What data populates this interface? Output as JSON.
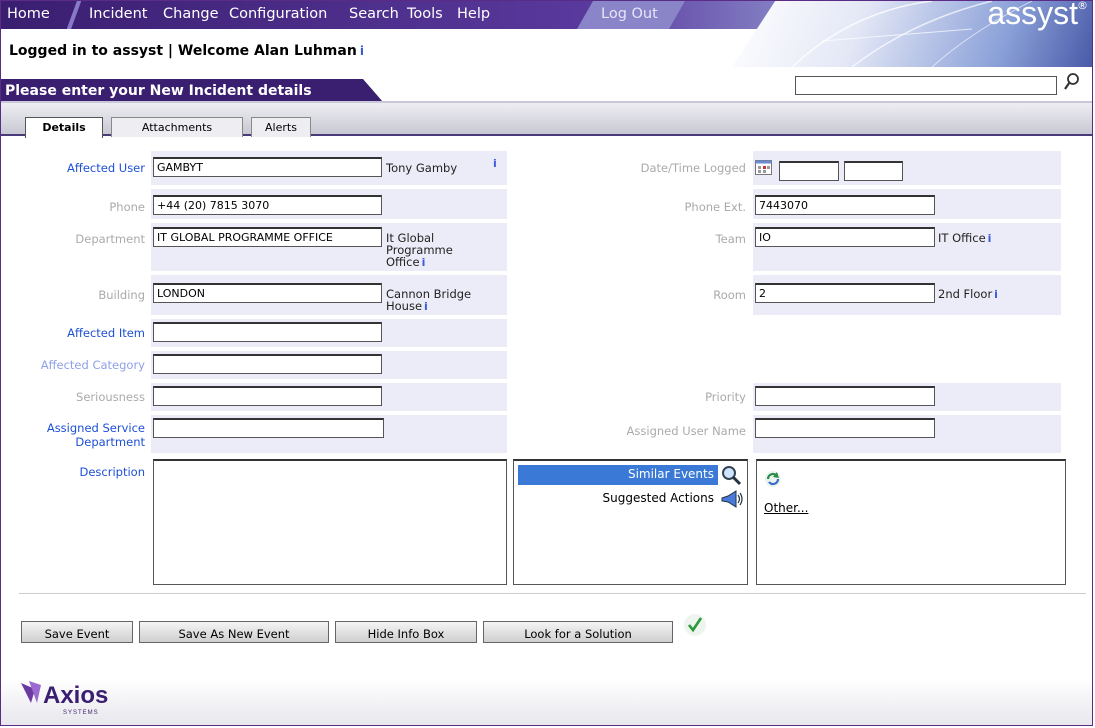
{
  "nav": {
    "home": "Home",
    "incident": "Incident",
    "change": "Change",
    "configuration": "Configuration",
    "search": "Search",
    "tools": "Tools",
    "help": "Help",
    "logout": "Log Out"
  },
  "brand": "assyst",
  "brand_reg": "®",
  "welcome": "Logged in to assyst | Welcome Alan Luhman",
  "banner": "Please enter your New Incident details",
  "search": {
    "value": ""
  },
  "tabs": [
    "Details",
    "Attachments",
    "Alerts"
  ],
  "info_glyph": "i",
  "form": {
    "affected_user": {
      "label": "Affected User",
      "value": "GAMBYT",
      "display": "Tony Gamby"
    },
    "phone": {
      "label": "Phone",
      "value": "+44 (20) 7815 3070"
    },
    "department": {
      "label": "Department",
      "value": "IT GLOBAL PROGRAMME OFFICE",
      "display_l1": "It Global",
      "display_l2": "Programme",
      "display_l3": "Office"
    },
    "building": {
      "label": "Building",
      "value": "LONDON",
      "display_l1": "Cannon Bridge",
      "display_l2": "House"
    },
    "affected_item": {
      "label": "Affected Item",
      "value": ""
    },
    "affected_category": {
      "label": "Affected Category",
      "value": ""
    },
    "seriousness": {
      "label": "Seriousness",
      "value": ""
    },
    "assigned_service_department": {
      "label_l1": "Assigned Service",
      "label_l2": "Department",
      "value": ""
    },
    "description": {
      "label": "Description",
      "value": ""
    },
    "date_time_logged": {
      "label": "Date/Time Logged",
      "date": "",
      "time": ""
    },
    "phone_ext": {
      "label": "Phone Ext.",
      "value": "7443070"
    },
    "team": {
      "label": "Team",
      "value": "IO",
      "display": "IT Office"
    },
    "room": {
      "label": "Room",
      "value": "2",
      "display": "2nd Floor"
    },
    "priority": {
      "label": "Priority",
      "value": ""
    },
    "assigned_user_name": {
      "label": "Assigned User Name",
      "value": ""
    }
  },
  "info_box": {
    "similar_events": "Similar Events",
    "suggested_actions": "Suggested Actions",
    "other": "Other..."
  },
  "buttons": {
    "save_event": "Save Event",
    "save_as_new": "Save As New Event",
    "hide_info": "Hide Info Box",
    "look_solution": "Look for a Solution"
  },
  "footer": {
    "logo": "Axios",
    "logo_sub": "SYSTEMS"
  },
  "colors": {
    "nav_purple": "#3a1e70",
    "label_blue": "#1e50d6",
    "label_grey": "#aaaaaa",
    "field_bg": "#ececf8",
    "highlight": "#3a7ad6"
  }
}
